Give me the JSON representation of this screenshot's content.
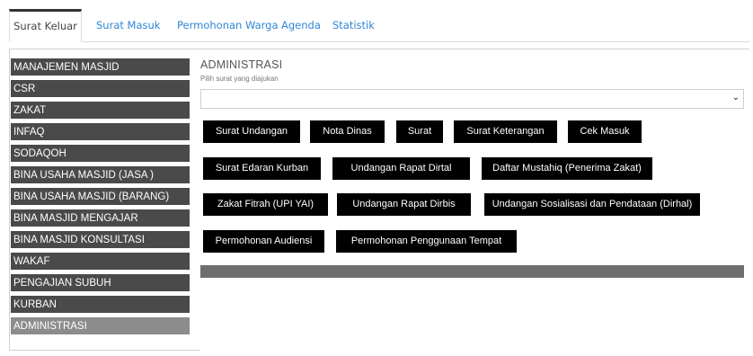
{
  "tabs": [
    {
      "label": "Surat Keluar",
      "active": true
    },
    {
      "label": "Surat Masuk"
    },
    {
      "label": "Permohonan Warga"
    },
    {
      "label": "Agenda"
    },
    {
      "label": "Statistik"
    }
  ],
  "sidebar": {
    "items": [
      {
        "label": "MANAJEMEN MASJID"
      },
      {
        "label": "CSR"
      },
      {
        "label": "ZAKAT"
      },
      {
        "label": "INFAQ"
      },
      {
        "label": "SODAQOH"
      },
      {
        "label": "BINA USAHA MASJID (JASA )"
      },
      {
        "label": "BINA USAHA MASJID (BARANG)"
      },
      {
        "label": "BINA MASJID MENGAJAR"
      },
      {
        "label": "BINA MASJID KONSULTASI"
      },
      {
        "label": "WAKAF"
      },
      {
        "label": "PENGAJIAN SUBUH"
      },
      {
        "label": "KURBAN"
      },
      {
        "label": "ADMINISTRASI",
        "active": true
      }
    ]
  },
  "content": {
    "title": "ADMINISTRASI",
    "subtitle": "Pilih surat yang diajukan",
    "select_value": "",
    "buttons": [
      "Surat Undangan",
      "Nota Dinas",
      "Surat",
      "Surat Keterangan",
      "Cek Masuk",
      "Surat Edaran Kurban",
      "Undangan Rapat Dirtal",
      "Daftar Mustahiq (Penerima Zakat)",
      "Zakat Fitrah (UPI YAI)",
      "Undangan Rapat Dirbis",
      "Undangan Sosialisasi dan Pendataan (Dirhal)",
      "Permohonan Audiensi",
      "Permohonan Penggunaan Tempat"
    ]
  },
  "icons": {
    "select_chevron": "chevron-down-icon"
  }
}
